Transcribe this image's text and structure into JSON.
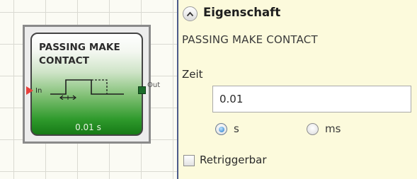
{
  "block": {
    "title": "PASSING MAKE CONTACT",
    "input_label": "In",
    "output_label": "Out",
    "value_text": "0.01 s"
  },
  "panel": {
    "header": "Eigenschaft",
    "block_name": "PASSING MAKE CONTACT",
    "time": {
      "label": "Zeit",
      "value": "0.01",
      "units": [
        {
          "label": "s",
          "selected": true
        },
        {
          "label": "ms",
          "selected": false
        }
      ]
    },
    "retrigger": {
      "label": "Retriggerbar",
      "checked": false
    }
  },
  "colors": {
    "panel_background": "#fcfadc",
    "block_green": "#2f9a2c",
    "input_arrow": "#e8413c",
    "output_square": "#1b6b2a"
  },
  "icons": [
    "chevron-up-icon",
    "pulse-timing-icon"
  ]
}
